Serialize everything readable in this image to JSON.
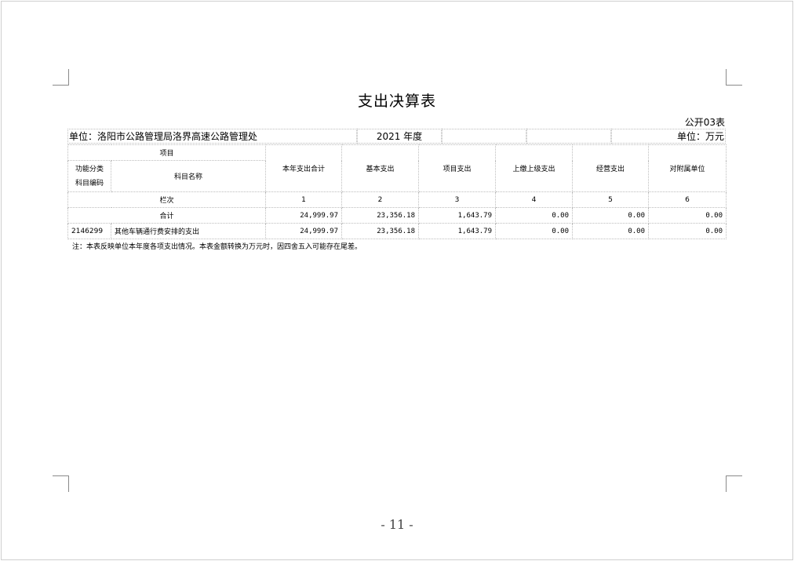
{
  "title": "支出决算表",
  "form_no": "公开03表",
  "unit_line": "单位：洛阳市公路管理局洛界高速公路管理处",
  "year": "2021 年度",
  "unit_measure": "单位：万元",
  "headers": {
    "item": "项目",
    "func_class": "功能分类",
    "subject_code": "科目编码",
    "subject_name": "科目名称",
    "total": "本年支出合计",
    "basic": "基本支出",
    "project": "项目支出",
    "upper": "上缴上级支出",
    "business": "经营支出",
    "subsidiary": "对附属单位"
  },
  "column_index_label": "栏次",
  "column_index": [
    "1",
    "2",
    "3",
    "4",
    "5",
    "6"
  ],
  "total_row": {
    "label": "合计",
    "values": [
      "24,999.97",
      "23,356.18",
      "1,643.79",
      "0.00",
      "0.00",
      "0.00"
    ]
  },
  "rows": [
    {
      "code": "2146299",
      "name": "其他车辆通行费安排的支出",
      "values": [
        "24,999.97",
        "23,356.18",
        "1,643.79",
        "0.00",
        "0.00",
        "0.00"
      ]
    }
  ],
  "note": "注：本表反映单位本年度各项支出情况。本表金额转换为万元时，因四舍五入可能存在尾差。",
  "page_number": "- 11 -"
}
